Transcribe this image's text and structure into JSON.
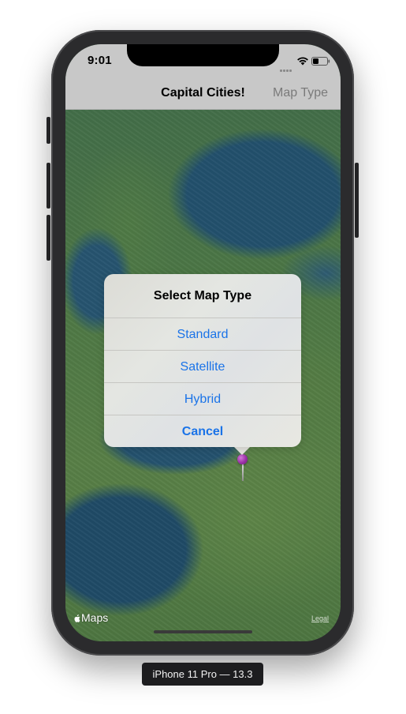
{
  "status_bar": {
    "time": "9:01"
  },
  "nav_bar": {
    "title": "Capital Cities!",
    "right_button": "Map Type"
  },
  "alert": {
    "title": "Select Map Type",
    "actions": [
      {
        "label": "Standard",
        "style": "default"
      },
      {
        "label": "Satellite",
        "style": "default"
      },
      {
        "label": "Hybrid",
        "style": "default"
      },
      {
        "label": "Cancel",
        "style": "cancel"
      }
    ]
  },
  "map": {
    "logo_text": "Maps",
    "legal_label": "Legal",
    "pin_color": "#9a2fa6"
  },
  "device": {
    "label": "iPhone 11 Pro — 13.3"
  },
  "colors": {
    "accent": "#1a73e8",
    "nav_bar": "#c8c8c8"
  }
}
